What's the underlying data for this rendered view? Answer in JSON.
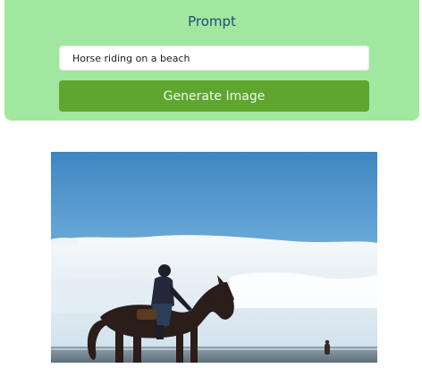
{
  "prompt_panel": {
    "title": "Prompt",
    "input_value": "Horse riding on a beach",
    "button_label": "Generate Image",
    "background_color": "#a1e7a0",
    "button_color": "#5ea62e",
    "title_color": "#234a78"
  },
  "generated_image": {
    "alt": "Horse riding on a beach"
  }
}
